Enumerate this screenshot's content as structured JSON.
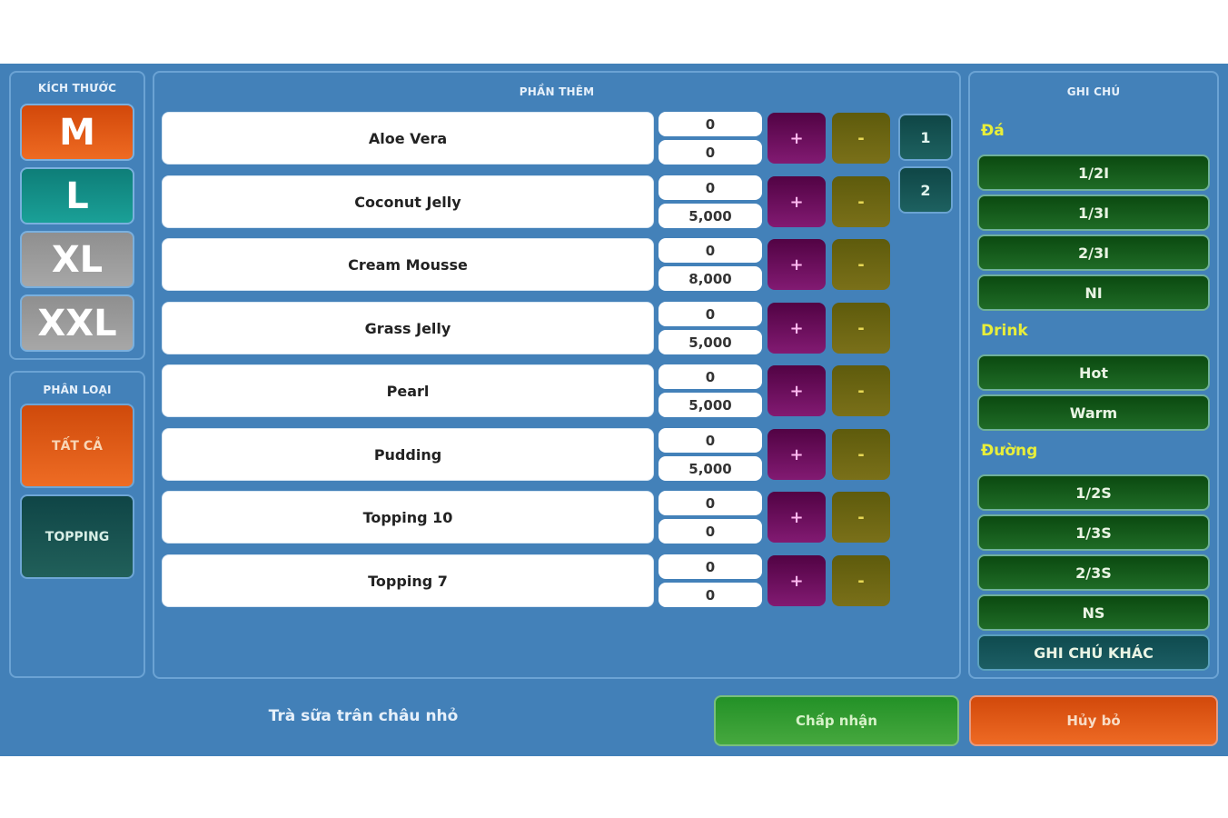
{
  "size_panel": {
    "title": "KÍCH THƯỚC",
    "sizes": [
      {
        "label": "M",
        "color": "#e25a16"
      },
      {
        "label": "L",
        "color": "#138f87"
      },
      {
        "label": "XL",
        "color": "#9b9b9b"
      },
      {
        "label": "XXL",
        "color": "#9b9b9b"
      }
    ]
  },
  "category_panel": {
    "title": "PHÂN LOẠI",
    "categories": [
      {
        "label": "TẤT CẢ",
        "color": "#e25a16"
      },
      {
        "label": "TOPPING",
        "color": "#175350"
      }
    ]
  },
  "toppings_panel": {
    "title": "PHẦN THÊM",
    "plus_label": "+",
    "minus_label": "-",
    "items": [
      {
        "name": "Aloe Vera",
        "quantity": "0",
        "price": "0"
      },
      {
        "name": "Coconut Jelly",
        "quantity": "0",
        "price": "5,000"
      },
      {
        "name": "Cream Mousse",
        "quantity": "0",
        "price": "8,000"
      },
      {
        "name": "Grass Jelly",
        "quantity": "0",
        "price": "5,000"
      },
      {
        "name": "Pearl",
        "quantity": "0",
        "price": "5,000"
      },
      {
        "name": "Pudding",
        "quantity": "0",
        "price": "5,000"
      },
      {
        "name": "Topping 10",
        "quantity": "0",
        "price": "0"
      },
      {
        "name": "Topping 7",
        "quantity": "0",
        "price": "0"
      }
    ],
    "pages": [
      "1",
      "2"
    ]
  },
  "notes_panel": {
    "title": "GHI CHÚ",
    "sections": [
      {
        "label": "Đá",
        "options": [
          "1/2I",
          "1/3I",
          "2/3I",
          "NI"
        ]
      },
      {
        "label": "Drink",
        "options": [
          "Hot",
          "Warm"
        ]
      },
      {
        "label": "Đường",
        "options": [
          "1/2S",
          "1/3S",
          "2/3S",
          "NS"
        ]
      }
    ],
    "other_note_label": "GHI CHÚ KHÁC"
  },
  "footer": {
    "product_name": "Trà sữa trân châu nhỏ",
    "accept_label": "Chấp nhận",
    "cancel_label": "Hủy bỏ"
  }
}
